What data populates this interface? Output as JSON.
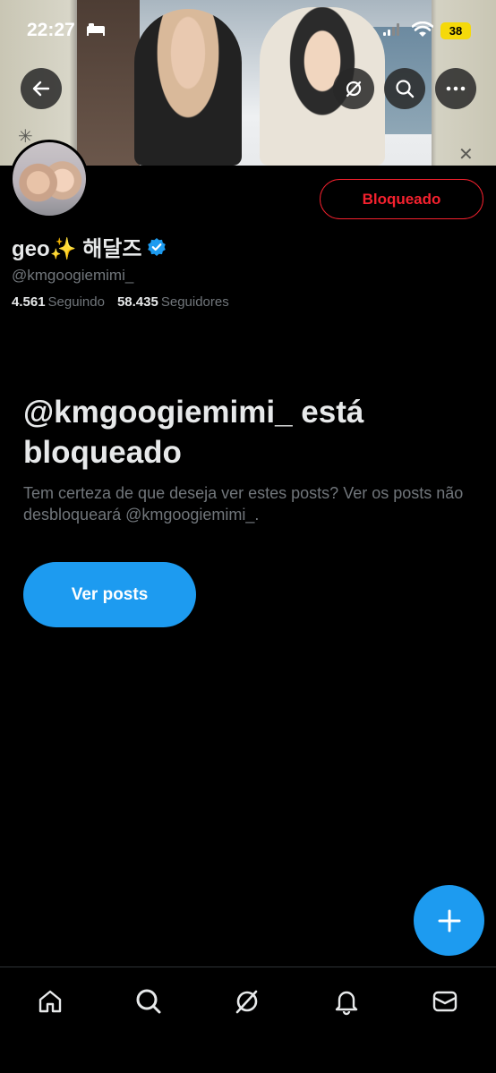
{
  "status_bar": {
    "time": "22:27",
    "battery": "38"
  },
  "profile": {
    "display_name": "geo✨ 해달즈",
    "handle": "@kmgoogiemimi_",
    "following_count": "4.561",
    "following_label": "Seguindo",
    "followers_count": "58.435",
    "followers_label": "Seguidores",
    "blocked_button_label": "Bloqueado"
  },
  "blocked_notice": {
    "title": "@kmgoogiemimi_ está bloqueado",
    "description": "Tem certeza de que deseja ver estes posts? Ver os posts não desbloqueará @kmgoogiemimi_.",
    "view_button_label": "Ver posts"
  },
  "header_actions": [
    "back-icon",
    "grok-icon",
    "search-icon",
    "more-icon"
  ],
  "bottom_nav": [
    "home-icon",
    "search-icon",
    "grok-icon",
    "notifications-icon",
    "messages-icon"
  ],
  "colors": {
    "accent": "#1d9bf0",
    "danger": "#f4212e",
    "secondary_text": "#71767b",
    "background": "#000000"
  }
}
